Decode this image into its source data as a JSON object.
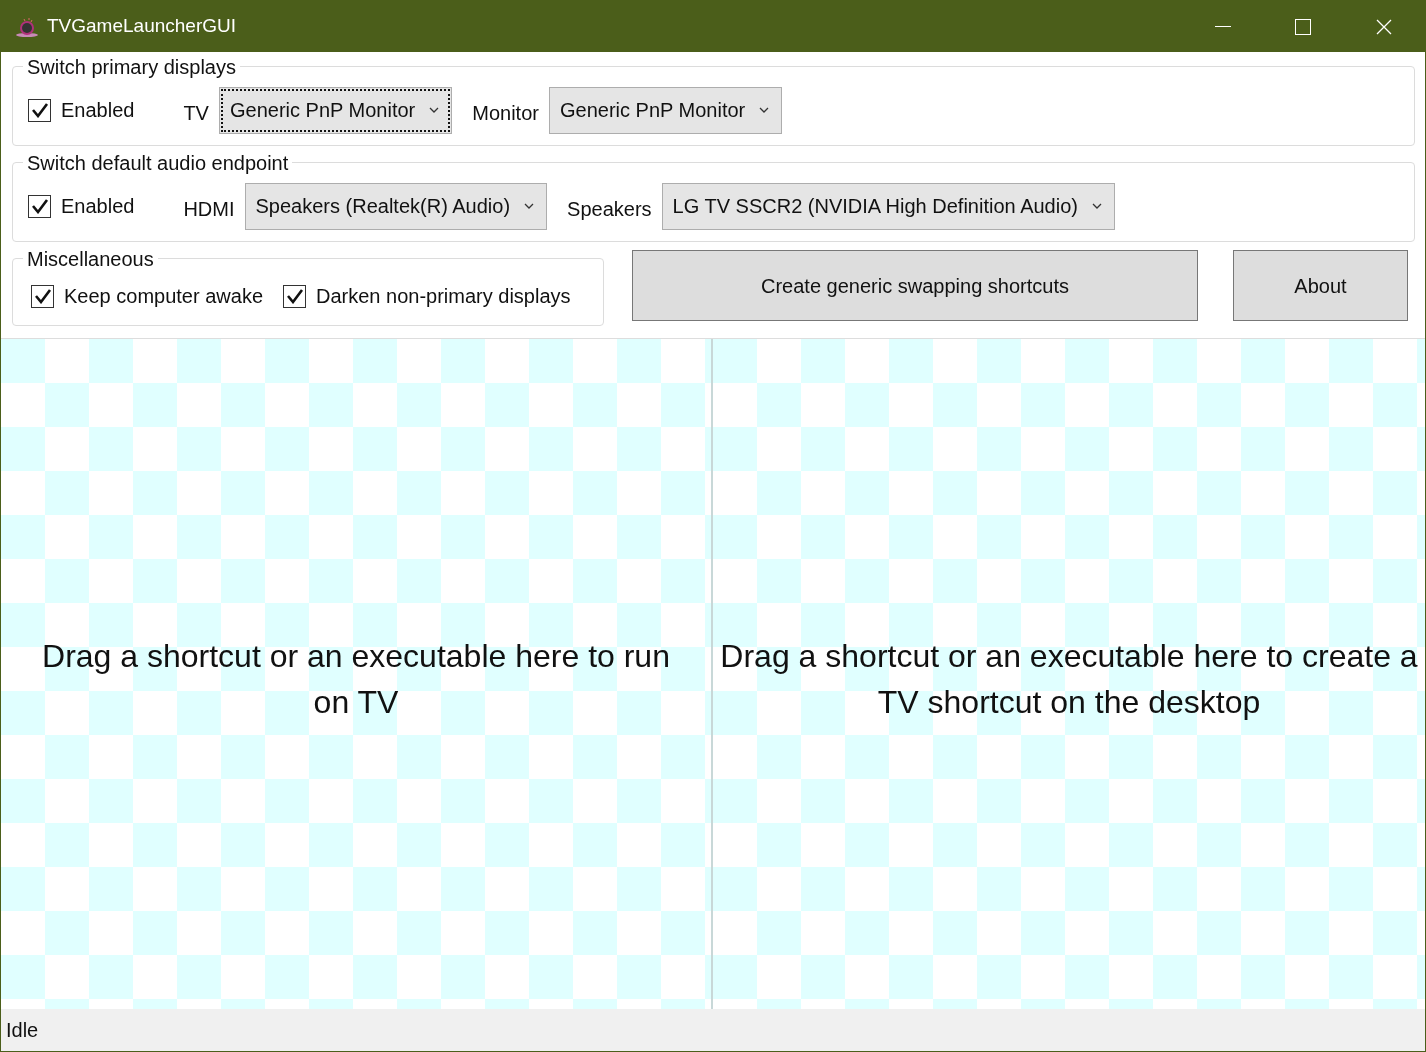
{
  "window": {
    "title": "TVGameLauncherGUI"
  },
  "display_group": {
    "title": "Switch primary displays",
    "enabled": {
      "label": "Enabled",
      "checked": true
    },
    "fields": [
      {
        "label": "TV",
        "value": "Generic PnP Monitor",
        "focused": true
      },
      {
        "label": "Monitor",
        "value": "Generic PnP Monitor",
        "focused": false
      }
    ]
  },
  "audio_group": {
    "title": "Switch default audio endpoint",
    "enabled": {
      "label": "Enabled",
      "checked": true
    },
    "fields": [
      {
        "label": "HDMI",
        "value": "Speakers (Realtek(R) Audio)",
        "focused": false
      },
      {
        "label": "Speakers",
        "value": "LG TV SSCR2 (NVIDIA High Definition Audio)",
        "focused": false
      }
    ]
  },
  "misc_group": {
    "title": "Miscellaneous",
    "options": [
      {
        "label": "Keep computer awake",
        "checked": true
      },
      {
        "label": "Darken non-primary displays",
        "checked": true
      }
    ]
  },
  "buttons": [
    "Create generic swapping shortcuts",
    "About"
  ],
  "drop_zones": [
    "Drag a shortcut or an executable here to run on TV",
    "Drag a shortcut or an executable here to create a TV shortcut on the desktop"
  ],
  "status_bar": "Idle"
}
